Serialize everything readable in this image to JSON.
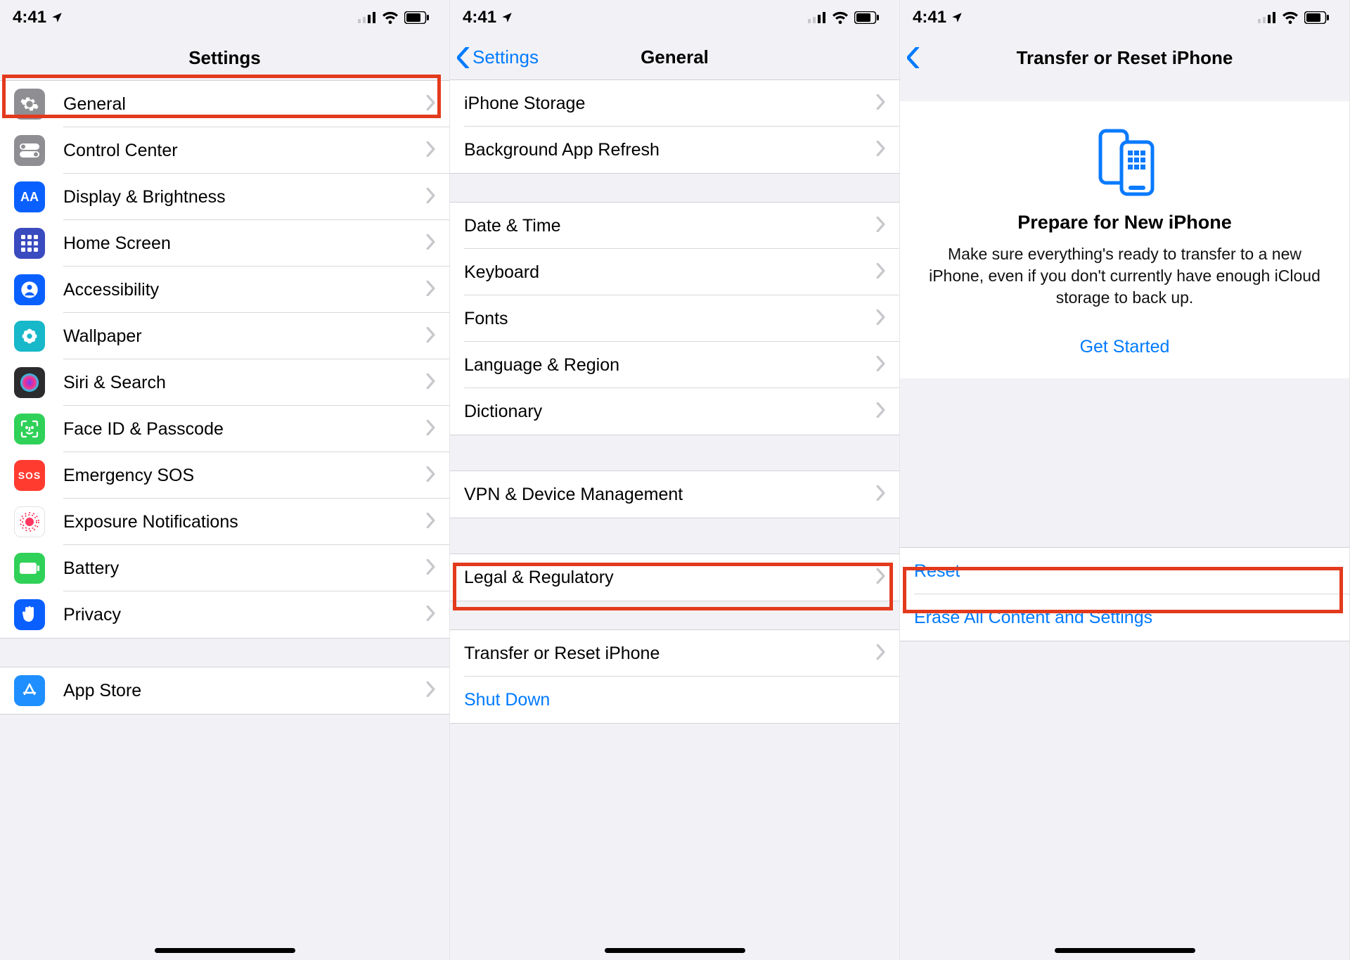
{
  "status": {
    "time": "4:41"
  },
  "screen1": {
    "title": "Settings",
    "rows": [
      {
        "id": "general",
        "label": "General",
        "icon": {
          "bg": "#8e8e93",
          "glyph": "gear"
        }
      },
      {
        "id": "control-center",
        "label": "Control Center",
        "icon": {
          "bg": "#8e8e93",
          "glyph": "toggles"
        }
      },
      {
        "id": "display",
        "label": "Display & Brightness",
        "icon": {
          "bg": "#0a60ff",
          "glyph": "AA"
        }
      },
      {
        "id": "home-screen",
        "label": "Home Screen",
        "icon": {
          "bg": "#3a4abf",
          "glyph": "gridapps"
        }
      },
      {
        "id": "accessibility",
        "label": "Accessibility",
        "icon": {
          "bg": "#0a60ff",
          "glyph": "person"
        }
      },
      {
        "id": "wallpaper",
        "label": "Wallpaper",
        "icon": {
          "bg": "#17b8c9",
          "glyph": "flower"
        }
      },
      {
        "id": "siri",
        "label": "Siri & Search",
        "icon": {
          "bg": "#2c2c2e",
          "glyph": "siri"
        }
      },
      {
        "id": "faceid",
        "label": "Face ID & Passcode",
        "icon": {
          "bg": "#30d158",
          "glyph": "faceid"
        }
      },
      {
        "id": "sos",
        "label": "Emergency SOS",
        "icon": {
          "bg": "#ff3b30",
          "glyph": "SOS"
        }
      },
      {
        "id": "exposure",
        "label": "Exposure Notifications",
        "icon": {
          "bg": "#ffffff",
          "glyph": "exposure"
        }
      },
      {
        "id": "battery",
        "label": "Battery",
        "icon": {
          "bg": "#30d158",
          "glyph": "battery"
        }
      },
      {
        "id": "privacy",
        "label": "Privacy",
        "icon": {
          "bg": "#0a60ff",
          "glyph": "hand"
        }
      }
    ],
    "rows2": [
      {
        "id": "app-store",
        "label": "App Store",
        "icon": {
          "bg": "#1f8fff",
          "glyph": "appstore"
        }
      }
    ]
  },
  "screen2": {
    "back": "Settings",
    "title": "General",
    "group1": [
      {
        "id": "iphone-storage",
        "label": "iPhone Storage"
      },
      {
        "id": "bg-refresh",
        "label": "Background App Refresh"
      }
    ],
    "group2": [
      {
        "id": "date-time",
        "label": "Date & Time"
      },
      {
        "id": "keyboard",
        "label": "Keyboard"
      },
      {
        "id": "fonts",
        "label": "Fonts"
      },
      {
        "id": "lang",
        "label": "Language & Region"
      },
      {
        "id": "dict",
        "label": "Dictionary"
      }
    ],
    "group3": [
      {
        "id": "vpn",
        "label": "VPN & Device Management"
      }
    ],
    "group4": [
      {
        "id": "legal",
        "label": "Legal & Regulatory"
      }
    ],
    "group5": [
      {
        "id": "transfer-reset",
        "label": "Transfer or Reset iPhone"
      },
      {
        "id": "shutdown",
        "label": "Shut Down",
        "blue": true,
        "noChevron": true
      }
    ]
  },
  "screen3": {
    "title": "Transfer or Reset iPhone",
    "card": {
      "heading": "Prepare for New iPhone",
      "desc": "Make sure everything's ready to transfer to a new iPhone, even if you don't currently have enough iCloud storage to back up.",
      "cta": "Get Started"
    },
    "rows": [
      {
        "id": "reset",
        "label": "Reset"
      },
      {
        "id": "erase",
        "label": "Erase All Content and Settings"
      }
    ]
  }
}
